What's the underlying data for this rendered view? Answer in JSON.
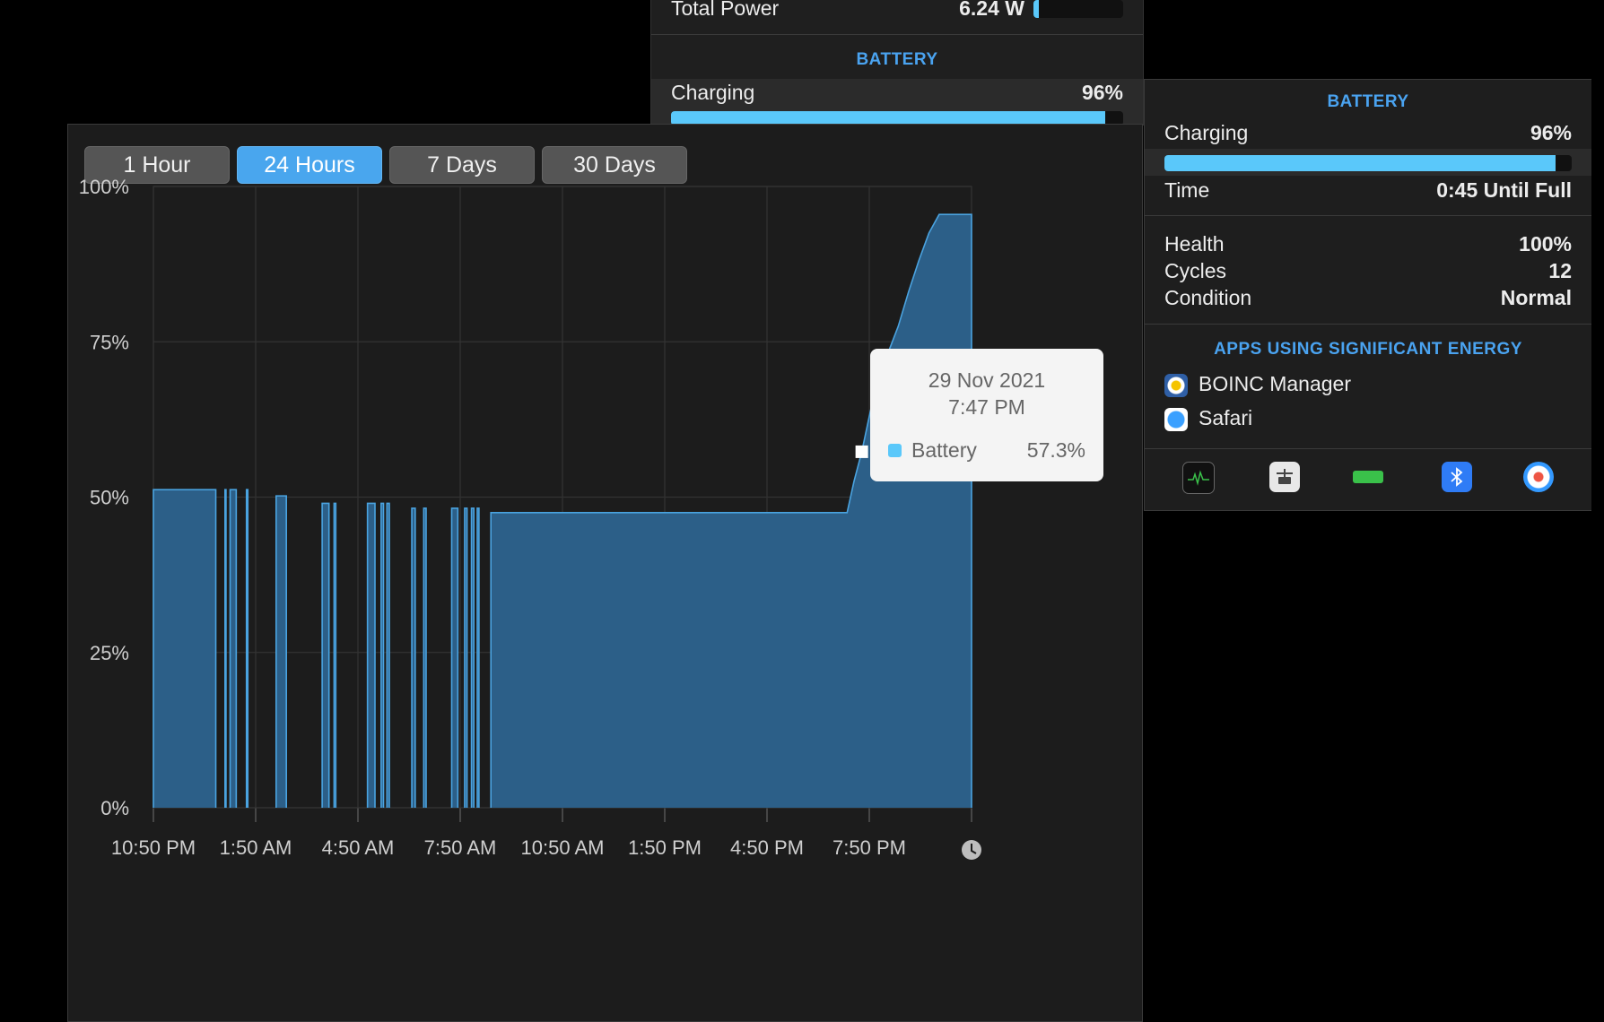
{
  "top_panel": {
    "total_power_label": "Total Power",
    "total_power_value": "6.24 W",
    "total_power_fraction": 0.06,
    "section_header": "BATTERY",
    "charging_label": "Charging",
    "charging_value": "96%",
    "charge_fraction": 0.96
  },
  "right_panel": {
    "section_header": "BATTERY",
    "charging_label": "Charging",
    "charging_value": "96%",
    "charge_fraction": 0.96,
    "time_label": "Time",
    "time_value": "0:45 Until Full",
    "health_label": "Health",
    "health_value": "100%",
    "cycles_label": "Cycles",
    "cycles_value": "12",
    "condition_label": "Condition",
    "condition_value": "Normal",
    "apps_header": "APPS USING SIGNIFICANT ENERGY",
    "apps": [
      {
        "name": "BOINC Manager",
        "icon": "boinc-icon"
      },
      {
        "name": "Safari",
        "icon": "safari-icon"
      }
    ],
    "toolbar_icons": [
      "activity-monitor-icon",
      "network-icon",
      "battery-icon",
      "bluetooth-icon",
      "gauge-icon"
    ]
  },
  "main_window": {
    "range_buttons": [
      {
        "label": "1 Hour",
        "active": false
      },
      {
        "label": "24 Hours",
        "active": true
      },
      {
        "label": "7 Days",
        "active": false
      },
      {
        "label": "30 Days",
        "active": false
      }
    ],
    "tooltip": {
      "date": "29 Nov 2021",
      "time": "7:47 PM",
      "series": "Battery",
      "value": "57.3%"
    },
    "clock_icon": "clock-icon"
  },
  "chart_data": {
    "type": "area",
    "series": [
      {
        "name": "Battery"
      }
    ],
    "x_ticks": [
      "10:50 PM",
      "1:50 AM",
      "4:50 AM",
      "7:50 AM",
      "10:50 AM",
      "1:50 PM",
      "4:50 PM",
      "7:50 PM"
    ],
    "y_ticks": [
      "100%",
      "75%",
      "50%",
      "25%",
      "0%"
    ],
    "ylim": [
      0,
      100
    ],
    "x_range_hours": [
      0,
      24
    ],
    "grid": true,
    "colors": {
      "fill": "#2c5f88",
      "stroke": "#4aa3e0"
    },
    "segments": [
      [
        [
          0,
          51.2
        ],
        [
          1.83,
          51.2
        ]
      ],
      [
        [
          2.1,
          51.2
        ],
        [
          2.13,
          51.2
        ]
      ],
      [
        [
          2.25,
          51.2
        ],
        [
          2.43,
          51.2
        ]
      ],
      [
        [
          2.73,
          51.2
        ],
        [
          2.77,
          51.2
        ]
      ],
      [
        [
          3.6,
          50.2
        ],
        [
          3.9,
          50.2
        ]
      ],
      [
        [
          4.95,
          49
        ],
        [
          5.15,
          49
        ]
      ],
      [
        [
          5.3,
          49
        ],
        [
          5.35,
          49
        ]
      ],
      [
        [
          6.28,
          49
        ],
        [
          6.5,
          49
        ]
      ],
      [
        [
          6.68,
          49
        ],
        [
          6.75,
          49
        ]
      ],
      [
        [
          6.85,
          49
        ],
        [
          6.92,
          49
        ]
      ],
      [
        [
          7.58,
          48.2
        ],
        [
          7.68,
          48.2
        ]
      ],
      [
        [
          7.93,
          48.2
        ],
        [
          8.0,
          48.2
        ]
      ],
      [
        [
          8.75,
          48.2
        ],
        [
          8.93,
          48.2
        ]
      ],
      [
        [
          9.13,
          48.2
        ],
        [
          9.2,
          48.2
        ]
      ],
      [
        [
          9.33,
          48.2
        ],
        [
          9.4,
          48.2
        ]
      ],
      [
        [
          9.5,
          48.2
        ],
        [
          9.55,
          48.2
        ]
      ],
      [
        [
          9.9,
          47.5
        ],
        [
          20.35,
          47.5
        ],
        [
          20.55,
          52.5
        ],
        [
          20.78,
          57.3
        ],
        [
          21.0,
          63
        ],
        [
          21.22,
          68.5
        ],
        [
          21.5,
          72.5
        ],
        [
          21.85,
          77.5
        ],
        [
          22.15,
          83
        ],
        [
          22.45,
          88
        ],
        [
          22.75,
          92.5
        ],
        [
          23.05,
          95.5
        ],
        [
          23.35,
          95.5
        ],
        [
          24.0,
          95.5
        ]
      ]
    ],
    "highlight_point": {
      "x": 20.78,
      "y": 57.3
    }
  }
}
